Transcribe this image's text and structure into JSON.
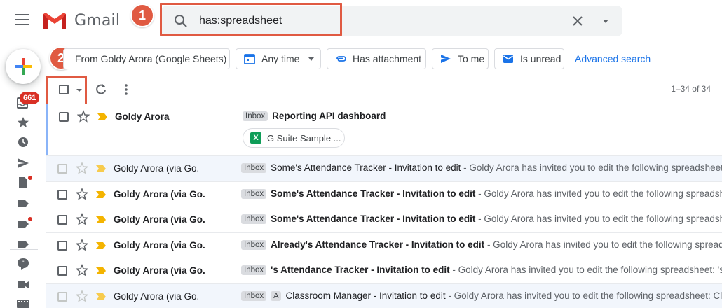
{
  "header": {
    "app_name": "Gmail",
    "search_value": "has:spreadsheet",
    "menu_icon": "hamburger-menu-icon",
    "search_icon": "search-icon",
    "clear_icon": "close-icon",
    "options_icon": "caret-down-icon"
  },
  "callouts": {
    "one": "1",
    "two": "2"
  },
  "sidebar": {
    "compose_icon": "plus-icon",
    "inbox_badge": "661",
    "items": [
      "inbox-icon",
      "star-icon",
      "clock-icon",
      "send-icon",
      "draft-icon",
      "label-icon",
      "label-icon",
      "label-icon",
      "chat-icon",
      "video-icon",
      "keyboard-icon"
    ]
  },
  "filters": {
    "from": "From Goldy Arora (Google Sheets)",
    "time": "Any time",
    "attachment": "Has attachment",
    "to_me": "To me",
    "unread": "Is unread",
    "advanced": "Advanced search"
  },
  "toolbar": {
    "count": "1–34 of 34"
  },
  "emails": [
    {
      "sender": "Goldy Arora",
      "label": "Inbox",
      "subject": "Reporting API dashboard",
      "snippet": "",
      "attachment": "G Suite Sample ...",
      "tag": ""
    },
    {
      "sender": "Goldy Arora (via Go.",
      "label": "Inbox",
      "subject": "Some's Attendance Tracker - Invitation to edit",
      "snippet": " - Goldy Arora has invited you to edit the following spreadsheet: Sc",
      "tag": ""
    },
    {
      "sender": "Goldy Arora (via Go.",
      "label": "Inbox",
      "subject": "Some's Attendance Tracker - Invitation to edit",
      "snippet": " - Goldy Arora has invited you to edit the following spreadsheet: Sc",
      "tag": ""
    },
    {
      "sender": "Goldy Arora (via Go.",
      "label": "Inbox",
      "subject": "Some's Attendance Tracker - Invitation to edit",
      "snippet": " - Goldy Arora has invited you to edit the following spreadsheet: Sc",
      "tag": ""
    },
    {
      "sender": "Goldy Arora (via Go.",
      "label": "Inbox",
      "subject": "Already's Attendance Tracker - Invitation to edit",
      "snippet": " - Goldy Arora has invited you to edit the following spreadshe",
      "tag": ""
    },
    {
      "sender": "Goldy Arora (via Go.",
      "label": "Inbox",
      "subject": "'s Attendance Tracker - Invitation to edit",
      "snippet": " - Goldy Arora has invited you to edit the following spreadsheet: 's Atten",
      "tag": ""
    },
    {
      "sender": "Goldy Arora (via Go.",
      "label": "Inbox",
      "subject": "Classroom Manager - Invitation to edit",
      "snippet": " - Goldy Arora has invited you to edit the following spreadsheet: Classr",
      "tag": "A"
    }
  ],
  "colors": {
    "accent": "#1a73e8",
    "callout": "#e05a42",
    "badge": "#d93025",
    "importance": "#f4b400",
    "sheets": "#0f9d58"
  }
}
